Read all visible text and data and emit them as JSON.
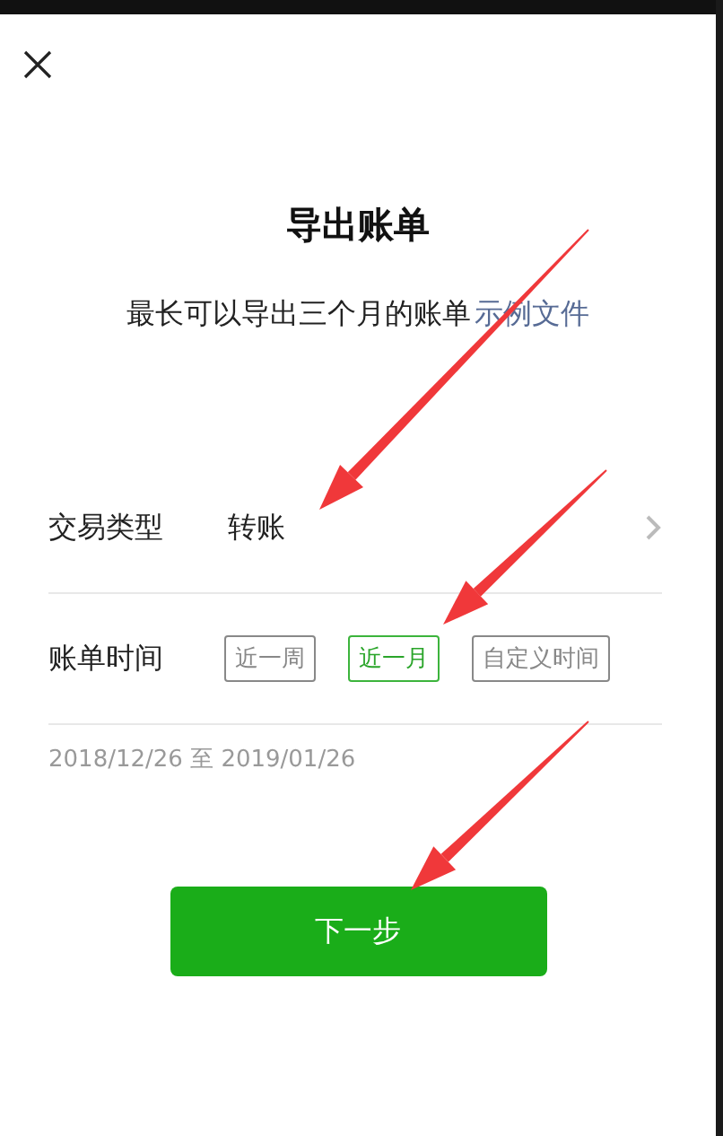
{
  "title": "导出账单",
  "subtitle": {
    "text": "最长可以导出三个月的账单",
    "link": "示例文件"
  },
  "type_row": {
    "label": "交易类型",
    "value": "转账"
  },
  "time_row": {
    "label": "账单时间",
    "options": [
      {
        "label": "近一周",
        "selected": false
      },
      {
        "label": "近一月",
        "selected": true
      },
      {
        "label": "自定义时间",
        "selected": false
      }
    ]
  },
  "range": "2018/12/26 至 2019/01/26",
  "next_button": "下一步"
}
